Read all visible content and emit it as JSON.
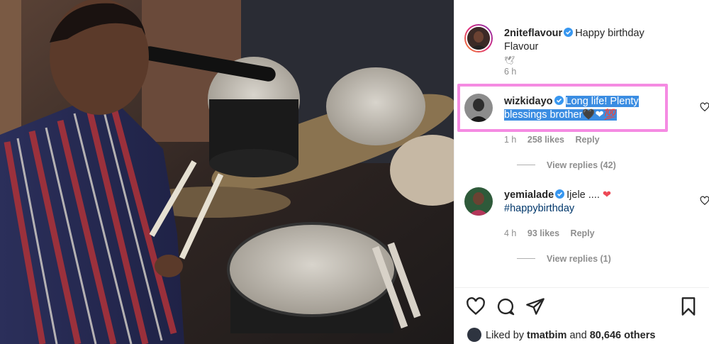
{
  "post": {
    "liked_by_prefix": "Liked by",
    "liked_by_user": "tmatbim",
    "liked_by_and": "and",
    "liked_by_count": "80,646 others"
  },
  "comments": [
    {
      "username": "2niteflavour",
      "text": "Happy birthday Flavour",
      "second_line": "🕊",
      "time": "6 h"
    },
    {
      "username": "wizkidayo",
      "text_line1": "Long life! Plenty",
      "text_line2": "blessings brother",
      "emojis": "🖤❤💯",
      "time": "1 h",
      "likes": "258 likes",
      "reply": "Reply",
      "view_replies": "View replies (42)"
    },
    {
      "username": "yemialade",
      "text": "Ijele ....",
      "emoji": "❤",
      "hashtag": "#happybirthday",
      "time": "4 h",
      "likes": "93 likes",
      "reply": "Reply",
      "view_replies": "View replies (1)"
    }
  ],
  "icons": {
    "like": "heart-icon",
    "comment": "comment-icon",
    "share": "share-icon",
    "save": "bookmark-icon"
  },
  "colors": {
    "highlight": "#3b8de2",
    "annotation_box": "#f58be2",
    "verified": "#3897f0",
    "heart_red": "#ed4956"
  }
}
